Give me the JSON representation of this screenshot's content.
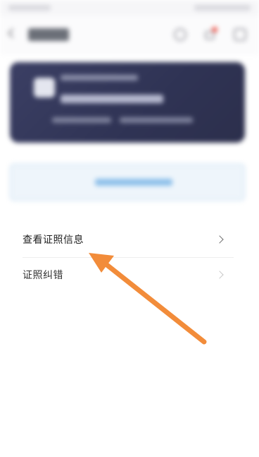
{
  "menu": {
    "items": [
      {
        "label": "查看证照信息"
      },
      {
        "label": "证照纠错"
      }
    ]
  },
  "colors": {
    "card_background": "#2f3354",
    "annotation_arrow": "#f28c3a",
    "notification_dot": "#f05a4f"
  },
  "icons": [
    "back-icon",
    "search-icon",
    "message-icon",
    "menu-icon",
    "chevron-right-icon"
  ]
}
